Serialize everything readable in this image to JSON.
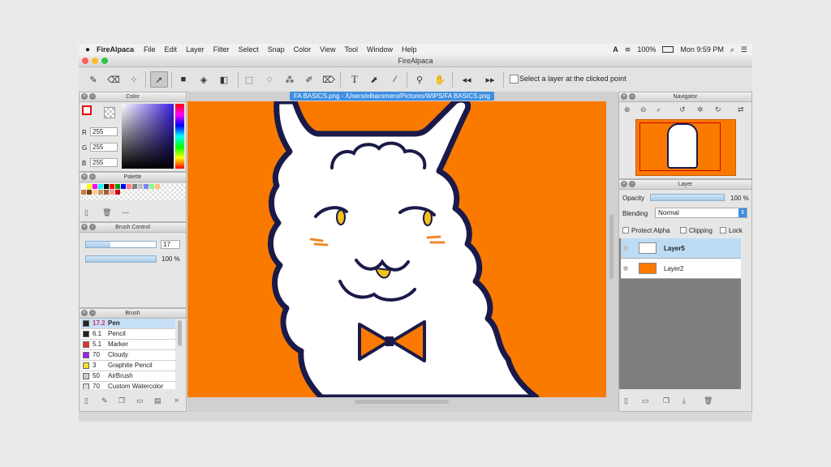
{
  "menubar": {
    "app_name": "FireAlpaca",
    "items": [
      "File",
      "Edit",
      "Layer",
      "Filter",
      "Select",
      "Snap",
      "Color",
      "View",
      "Tool",
      "Window",
      "Help"
    ],
    "battery": "100%",
    "clock": "Mon 9:59 PM"
  },
  "window": {
    "title": "FireAlpaca"
  },
  "toolbar": {
    "option_label": "Select a layer at the clicked point"
  },
  "color_panel": {
    "title": "Color",
    "r_label": "R",
    "r_value": "255",
    "g_label": "G",
    "g_value": "255",
    "b_label": "B",
    "b_value": "255",
    "primary_color": "#ffffff"
  },
  "palette_panel": {
    "title": "Palette",
    "swatches": [
      "#ffffff",
      "#ffff00",
      "#ff00ff",
      "#00ffff",
      "#000000",
      "#ff0000",
      "#00a000",
      "#0000ff",
      "#ff8080",
      "#808080",
      "#c0c0c0",
      "#8080ff",
      "#80ff80",
      "#ffc080",
      "#c08040",
      "#804000",
      "#ffcc99",
      "#cc9966",
      "#996633",
      "#ff9999",
      "#cc0000"
    ],
    "dashes": "---"
  },
  "brush_control": {
    "title": "Brush Control",
    "size_value": "17",
    "size_level": 0.35,
    "opacity_value": "100 %",
    "opacity_level": 1.0
  },
  "brush_panel": {
    "title": "Brush",
    "items": [
      {
        "size": "17.2",
        "name": "Pen",
        "color": "#222222"
      },
      {
        "size": "6.1",
        "name": "Pencil",
        "color": "#222222"
      },
      {
        "size": "5.1",
        "name": "Marker",
        "color": "#e53030"
      },
      {
        "size": "70",
        "name": "Cloudy",
        "color": "#a020f0"
      },
      {
        "size": "3",
        "name": "Graphite Pencil",
        "color": "#f0e020"
      },
      {
        "size": "50",
        "name": "AirBrush",
        "color": "#cccccc"
      },
      {
        "size": "70",
        "name": "Custom Watercolor",
        "color": "#dddddd"
      }
    ]
  },
  "canvas": {
    "tab_title": "FA BASICS.png - /Users/elbaromero/Pictures/WIPS/FA BASICS.png",
    "background_color": "#fa7a00"
  },
  "navigator": {
    "title": "Navigator"
  },
  "layer_panel": {
    "title": "Layer",
    "opacity_label": "Opacity",
    "opacity_value": "100 %",
    "opacity_level": 1.0,
    "blending_label": "Blending",
    "blending_value": "Normal",
    "protect_alpha_label": "Protect Alpha",
    "clipping_label": "Clipping",
    "lock_label": "Lock",
    "layers": [
      {
        "name": "Layer5",
        "selected": true
      },
      {
        "name": "Layer2",
        "selected": false
      }
    ]
  }
}
